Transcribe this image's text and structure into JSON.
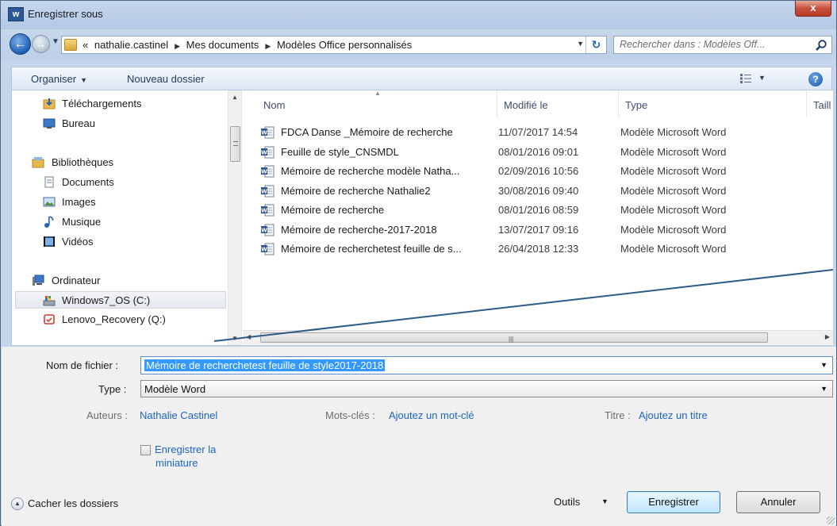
{
  "window": {
    "title": "Enregistrer sous",
    "app_icon_letter": "w",
    "close_label": "x"
  },
  "address": {
    "crumbs": [
      "«",
      "nathalie.castinel",
      "Mes documents",
      "Modèles Office personnalisés"
    ],
    "search_placeholder": "Rechercher dans : Modèles Off..."
  },
  "toolbar": {
    "organize_label": "Organiser",
    "new_folder_label": "Nouveau dossier"
  },
  "nav": {
    "items": [
      {
        "label": "Téléchargements",
        "icon": "downloads-folder-icon",
        "indent": 1
      },
      {
        "label": "Bureau",
        "icon": "desktop-icon",
        "indent": 1
      },
      {
        "label": "Bibliothèques",
        "icon": "libraries-icon",
        "indent": 0
      },
      {
        "label": "Documents",
        "icon": "documents-icon",
        "indent": 1
      },
      {
        "label": "Images",
        "icon": "images-icon",
        "indent": 1
      },
      {
        "label": "Musique",
        "icon": "music-icon",
        "indent": 1
      },
      {
        "label": "Vidéos",
        "icon": "videos-icon",
        "indent": 1
      },
      {
        "label": "Ordinateur",
        "icon": "computer-icon",
        "indent": 0
      },
      {
        "label": "Windows7_OS (C:)",
        "icon": "system-drive-icon",
        "indent": 1,
        "selected": true
      },
      {
        "label": "Lenovo_Recovery (Q:)",
        "icon": "recovery-drive-icon",
        "indent": 1
      }
    ]
  },
  "files": {
    "columns": [
      "Nom",
      "Modifié le",
      "Type",
      "Taill"
    ],
    "rows": [
      {
        "name": "FDCA Danse _Mémoire de recherche",
        "modified": "11/07/2017 14:54",
        "type": "Modèle Microsoft Word"
      },
      {
        "name": "Feuille de style_CNSMDL",
        "modified": "08/01/2016 09:01",
        "type": "Modèle Microsoft Word"
      },
      {
        "name": "Mémoire de recherche modèle Natha...",
        "modified": "02/09/2016 10:56",
        "type": "Modèle Microsoft Word"
      },
      {
        "name": "Mémoire de recherche Nathalie2",
        "modified": "30/08/2016 09:40",
        "type": "Modèle Microsoft Word"
      },
      {
        "name": "Mémoire de recherche",
        "modified": "08/01/2016 08:59",
        "type": "Modèle Microsoft Word"
      },
      {
        "name": "Mémoire de recherche-2017-2018",
        "modified": "13/07/2017 09:16",
        "type": "Modèle Microsoft Word"
      },
      {
        "name": "Mémoire de recherchetest feuille de s...",
        "modified": "26/04/2018 12:33",
        "type": "Modèle Microsoft Word"
      }
    ]
  },
  "form": {
    "filename_label": "Nom de fichier :",
    "filename_value": "Mémoire de recherchetest feuille de style2017-2018",
    "type_label": "Type :",
    "type_value": "Modèle Word",
    "authors_label": "Auteurs :",
    "authors_value": "Nathalie Castinel",
    "keywords_label": "Mots-clés :",
    "keywords_value": "Ajoutez un mot-clé",
    "title_label": "Titre :",
    "title_value": "Ajoutez un titre",
    "thumbnail_label_line1": "Enregistrer la",
    "thumbnail_label_line2": "miniature"
  },
  "footer": {
    "hide_folders": "Cacher les dossiers",
    "tools": "Outils",
    "save": "Enregistrer",
    "cancel": "Annuler"
  },
  "colors": {
    "link_blue": "#1c65c2",
    "selection_blue": "#3399ff",
    "annotation_line": "#2e5b85"
  }
}
